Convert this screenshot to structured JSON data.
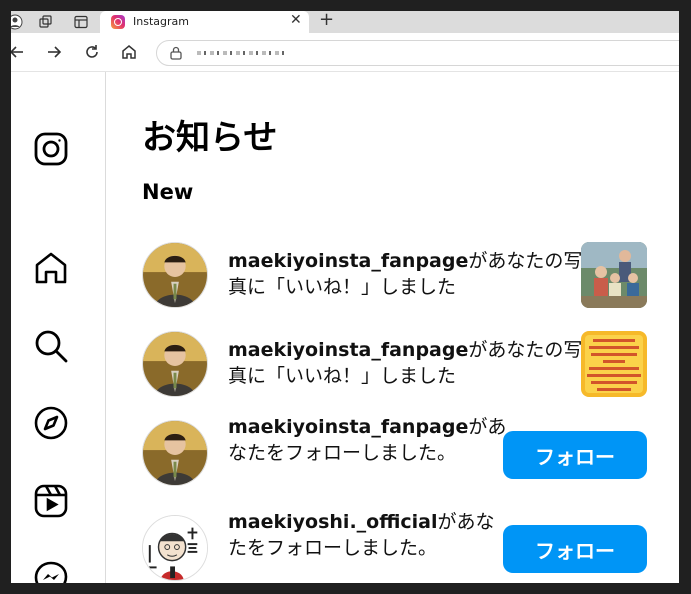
{
  "browser": {
    "tab": {
      "title": "Instagram",
      "favicon": "instagram-icon"
    },
    "toolbar_icons": [
      "profile-icon",
      "workspaces-icon",
      "tab-actions-icon",
      "close-icon",
      "plus-icon"
    ],
    "nav_icons": [
      "back-arrow-icon",
      "forward-arrow-icon",
      "reload-icon",
      "home-icon",
      "lock-icon"
    ]
  },
  "sidebar": {
    "icons": [
      "instagram-logo-icon",
      "home-icon",
      "search-icon",
      "explore-compass-icon",
      "reels-icon",
      "messenger-icon"
    ]
  },
  "page": {
    "title": "お知らせ",
    "section_title": "New"
  },
  "notifications": [
    {
      "username": "maekiyoinsta_fanpage",
      "line1_suffix": "があなたの写",
      "line2": "真に「いいね！」しました",
      "action": "thumbnail"
    },
    {
      "username": "maekiyoinsta_fanpage",
      "line1_suffix": "があなたの写",
      "line2": "真に「いいね！」しました",
      "action": "thumbnail"
    },
    {
      "username": "maekiyoinsta_fanpage",
      "line1_suffix": "があ",
      "line2": "なたをフォローしました。",
      "action": "follow",
      "button_label": "フォロー"
    },
    {
      "username": "maekiyoshi._official",
      "line1_suffix": "があな",
      "line2": "たをフォローしました。",
      "action": "follow",
      "button_label": "フォロー"
    }
  ],
  "colors": {
    "follow_button": "#0095f6",
    "accent_text": "#ffffff"
  }
}
